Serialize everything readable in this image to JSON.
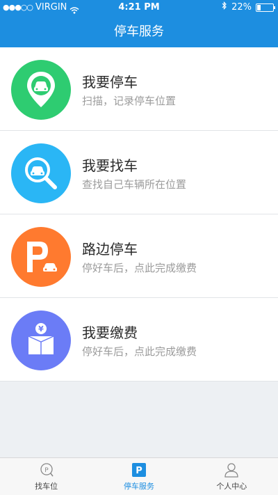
{
  "status_bar": {
    "carrier": "VIRGIN",
    "time": "4:21 PM",
    "battery": "22%"
  },
  "header": {
    "title": "停车服务"
  },
  "menu": [
    {
      "title": "我要停车",
      "subtitle": "扫描，记录停车位置",
      "icon": "map-pin-car-icon",
      "color": "#2ecc71"
    },
    {
      "title": "我要找车",
      "subtitle": "查找自己车辆所在位置",
      "icon": "magnifier-car-icon",
      "color": "#2ab6f5"
    },
    {
      "title": "路边停车",
      "subtitle": "停好车后，点此完成缴费",
      "icon": "parking-p-icon",
      "color": "#ff7a2f"
    },
    {
      "title": "我要缴费",
      "subtitle": "停好车后，点此完成缴费",
      "icon": "yen-box-icon",
      "color": "#6b7cf6"
    }
  ],
  "tabs": [
    {
      "label": "找车位",
      "icon": "parking-circle-icon",
      "active": false
    },
    {
      "label": "停车服务",
      "icon": "parking-square-icon",
      "active": true
    },
    {
      "label": "个人中心",
      "icon": "user-icon",
      "active": false
    }
  ]
}
